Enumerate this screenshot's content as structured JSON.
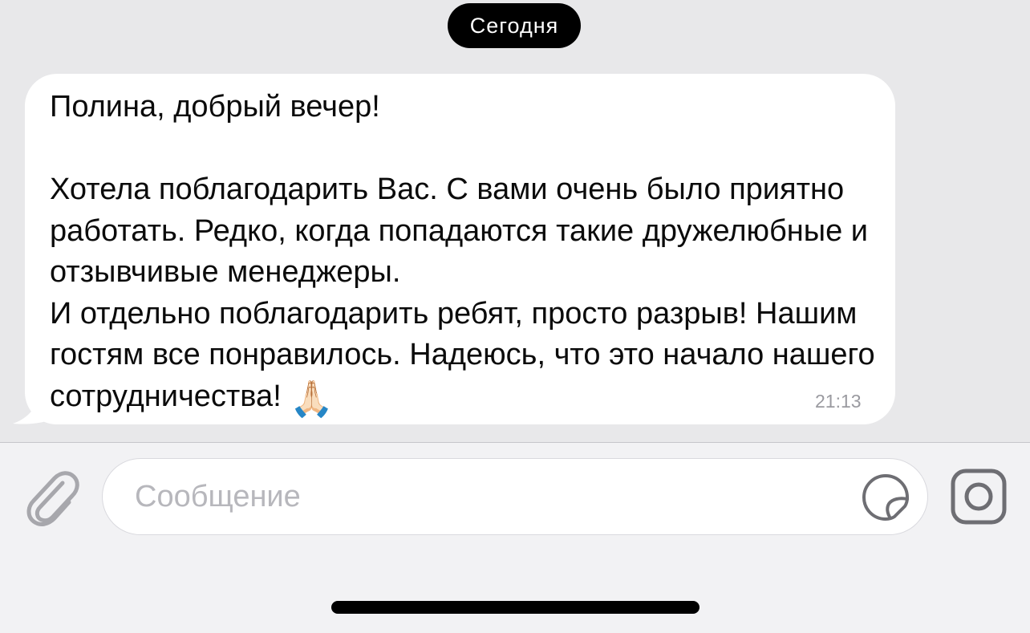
{
  "chat": {
    "date_divider": "Сегодня",
    "message": {
      "text": "Полина, добрый вечер!\n\nХотела поблагодарить Вас. С вами очень было приятно работать. Редко, когда попадаются такие дружелюбные и  отзывчивые менеджеры.\nИ отдельно поблагодарить ребят, просто разрыв! Нашим гостям все понравилось. Надеюсь, что это начало нашего сотрудничества! ",
      "emoji": "🙏🏻",
      "time": "21:13"
    }
  },
  "composer": {
    "placeholder": "Сообщение",
    "value": "",
    "icons": {
      "attach": "paperclip-icon",
      "sticker": "sticker-icon",
      "camera": "camera-icon"
    }
  },
  "colors": {
    "chat_background": "#e8e8ea",
    "bubble_background": "#ffffff",
    "date_pill": "#000000",
    "icon_gray": "#6e6e73"
  }
}
